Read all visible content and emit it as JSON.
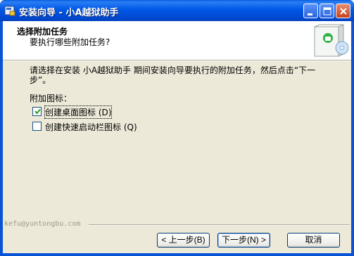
{
  "window": {
    "title": "安装向导 - 小A越狱助手"
  },
  "header": {
    "title": "选择附加任务",
    "subtitle": "要执行哪些附加任务?"
  },
  "body": {
    "intro": "请选择在安装 小A越狱助手 期间安装向导要执行的附加任务，然后点击“下一步”。",
    "group_label": "附加图标：",
    "options": [
      {
        "label": "创建桌面图标 (D)",
        "checked": true
      },
      {
        "label": "创建快速启动栏图标 (Q)",
        "checked": false
      }
    ]
  },
  "footer": {
    "brand": "kefu@yuntongbu.com",
    "back_label": "< 上一步(B)",
    "next_label": "下一步(N) >",
    "cancel_label": "取消"
  },
  "colors": {
    "titlebar": "#0058e6",
    "dialog_bg": "#ece9d8",
    "close_button": "#c8411b"
  },
  "icons": [
    "installer-app-icon",
    "minimize-icon",
    "maximize-icon",
    "close-icon",
    "software-box-icon",
    "checkmark-icon"
  ]
}
